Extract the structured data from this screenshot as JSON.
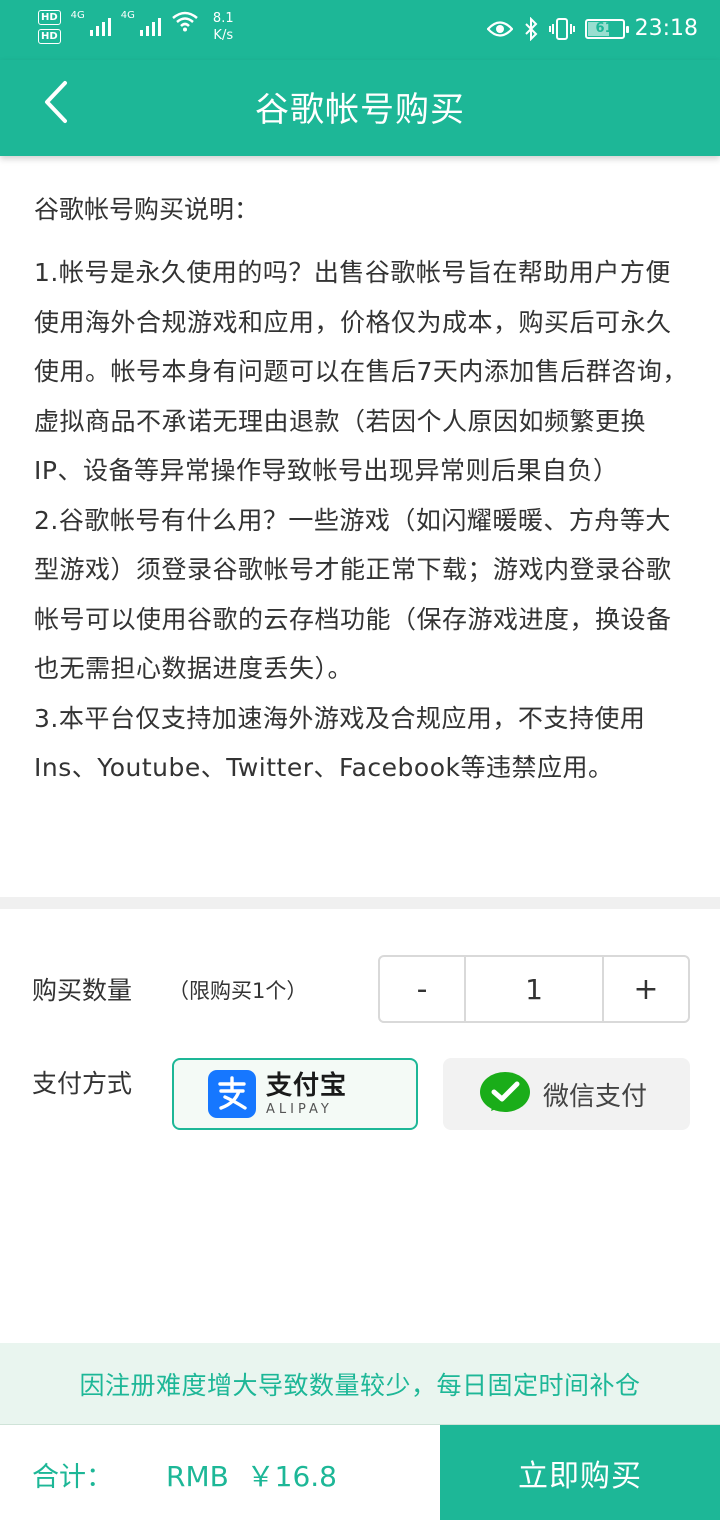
{
  "status_bar": {
    "hd1": "HD",
    "hd2": "HD",
    "sim1": "4G",
    "sim2": "4G",
    "net_speed_value": "8.1",
    "net_speed_unit": "K/s",
    "battery": "61",
    "time": "23:18"
  },
  "header": {
    "title": "谷歌帐号购买",
    "back_icon": "chevron-left-icon"
  },
  "description": {
    "title": "谷歌帐号购买说明：",
    "paragraph_1": "1.帐号是永久使用的吗？出售谷歌帐号旨在帮助用户方便使用海外合规游戏和应用，价格仅为成本，购买后可永久使用。帐号本身有问题可以在售后7天内添加售后群咨询，虚拟商品不承诺无理由退款（若因个人原因如频繁更换IP、设备等异常操作导致帐号出现异常则后果自负）",
    "paragraph_2": "2.谷歌帐号有什么用？一些游戏（如闪耀暖暖、方舟等大型游戏）须登录谷歌帐号才能正常下载；游戏内登录谷歌帐号可以使用谷歌的云存档功能（保存游戏进度，换设备也无需担心数据进度丢失）。",
    "paragraph_3": "3.本平台仅支持加速海外游戏及合规应用，不支持使用Ins、Youtube、Twitter、Facebook等违禁应用。"
  },
  "quantity": {
    "label": "购买数量",
    "limit": "（限购买1个）",
    "minus": "-",
    "value": "1",
    "plus": "+"
  },
  "payment": {
    "label": "支付方式",
    "alipay_cn": "支付宝",
    "alipay_en": "ALIPAY",
    "wechat": "微信支付",
    "selected": "alipay"
  },
  "notice": "因注册难度增大导致数量较少，每日固定时间补仓",
  "footer": {
    "total_label": "合计：",
    "total_value": "RMB  ￥16.8",
    "buy_button": "立即购买"
  },
  "colors": {
    "accent": "#1db797",
    "alipay_blue": "#1677ff",
    "wechat_green": "#1aad19"
  }
}
